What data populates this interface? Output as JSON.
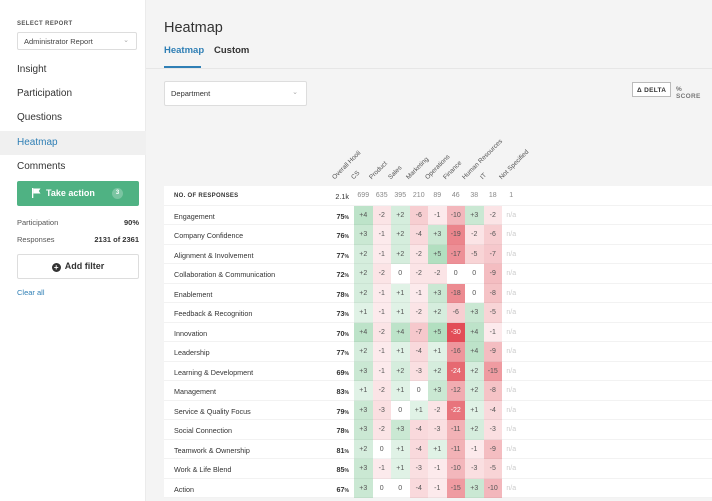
{
  "sidebar": {
    "select_label": "SELECT REPORT",
    "select_value": "Administrator Report",
    "nav": [
      {
        "label": "Insight"
      },
      {
        "label": "Participation"
      },
      {
        "label": "Questions"
      },
      {
        "label": "Heatmap",
        "active": true
      },
      {
        "label": "Comments"
      }
    ],
    "take_action": {
      "label": "Take action",
      "count": "3"
    },
    "stats": [
      {
        "label": "Participation",
        "value": "90%"
      },
      {
        "label": "Responses",
        "value": "2131 of 2361"
      }
    ],
    "add_filter": "Add filter",
    "clear_all": "Clear all"
  },
  "main": {
    "title": "Heatmap",
    "tabs": [
      {
        "label": "Heatmap",
        "active": true
      },
      {
        "label": "Custom"
      }
    ],
    "group_select": "Department",
    "toggles": {
      "delta": "Δ DELTA",
      "score": "% SCORE"
    }
  },
  "heatmap": {
    "overall_header": "Overall Hooli",
    "columns": [
      "CS",
      "Product",
      "Sales",
      "Marketing",
      "Operations",
      "Finance",
      "Human Resources",
      "IT",
      "Not Specified"
    ],
    "responses": {
      "label": "NO. OF RESPONSES",
      "overall": "2.1k",
      "values": [
        "699",
        "635",
        "395",
        "210",
        "89",
        "46",
        "38",
        "18",
        "1"
      ]
    },
    "rows": [
      {
        "label": "Engagement",
        "overall": "75",
        "values": [
          "+4",
          "-2",
          "+2",
          "-6",
          "-1",
          "-10",
          "+3",
          "-2",
          "n/a"
        ]
      },
      {
        "label": "Company Confidence",
        "overall": "76",
        "values": [
          "+3",
          "-1",
          "+2",
          "-4",
          "+3",
          "-19",
          "-2",
          "-6",
          "n/a"
        ]
      },
      {
        "label": "Alignment & Involvement",
        "overall": "77",
        "values": [
          "+2",
          "-1",
          "+2",
          "-2",
          "+5",
          "-17",
          "-5",
          "-7",
          "n/a"
        ]
      },
      {
        "label": "Collaboration & Communication",
        "overall": "72",
        "values": [
          "+2",
          "-2",
          "0",
          "-2",
          "-2",
          "0",
          "0",
          "-9",
          "n/a"
        ]
      },
      {
        "label": "Enablement",
        "overall": "78",
        "values": [
          "+2",
          "-1",
          "+1",
          "-1",
          "+3",
          "-18",
          "0",
          "-8",
          "n/a"
        ]
      },
      {
        "label": "Feedback & Recognition",
        "overall": "73",
        "values": [
          "+1",
          "-1",
          "+1",
          "-2",
          "+2",
          "-6",
          "+3",
          "-5",
          "n/a"
        ]
      },
      {
        "label": "Innovation",
        "overall": "70",
        "values": [
          "+4",
          "-2",
          "+4",
          "-7",
          "+5",
          "-30",
          "+4",
          "-1",
          "n/a"
        ]
      },
      {
        "label": "Leadership",
        "overall": "77",
        "values": [
          "+2",
          "-1",
          "+1",
          "-4",
          "+1",
          "-16",
          "+4",
          "-9",
          "n/a"
        ]
      },
      {
        "label": "Learning & Development",
        "overall": "69",
        "values": [
          "+3",
          "-1",
          "+2",
          "-3",
          "+2",
          "-24",
          "+2",
          "-15",
          "n/a"
        ]
      },
      {
        "label": "Management",
        "overall": "83",
        "values": [
          "+1",
          "-2",
          "+1",
          "0",
          "+3",
          "-12",
          "+2",
          "-8",
          "n/a"
        ]
      },
      {
        "label": "Service & Quality Focus",
        "overall": "79",
        "values": [
          "+3",
          "-3",
          "0",
          "+1",
          "-2",
          "-22",
          "+1",
          "-4",
          "n/a"
        ]
      },
      {
        "label": "Social Connection",
        "overall": "78",
        "values": [
          "+3",
          "-2",
          "+3",
          "-4",
          "-3",
          "-11",
          "+2",
          "-3",
          "n/a"
        ]
      },
      {
        "label": "Teamwork & Ownership",
        "overall": "81",
        "values": [
          "+2",
          "0",
          "+1",
          "-4",
          "+1",
          "-11",
          "-1",
          "-9",
          "n/a"
        ]
      },
      {
        "label": "Work & Life Blend",
        "overall": "85",
        "values": [
          "+3",
          "-1",
          "+1",
          "-3",
          "-1",
          "-10",
          "-3",
          "-5",
          "n/a"
        ]
      },
      {
        "label": "Action",
        "overall": "67",
        "values": [
          "+3",
          "0",
          "0",
          "-4",
          "-1",
          "-15",
          "+3",
          "-10",
          "n/a"
        ]
      }
    ],
    "percent_unit": "%",
    "colors": {
      "positive": "#3fae62",
      "negative": "#e0434e",
      "na": "#cccccc"
    }
  }
}
